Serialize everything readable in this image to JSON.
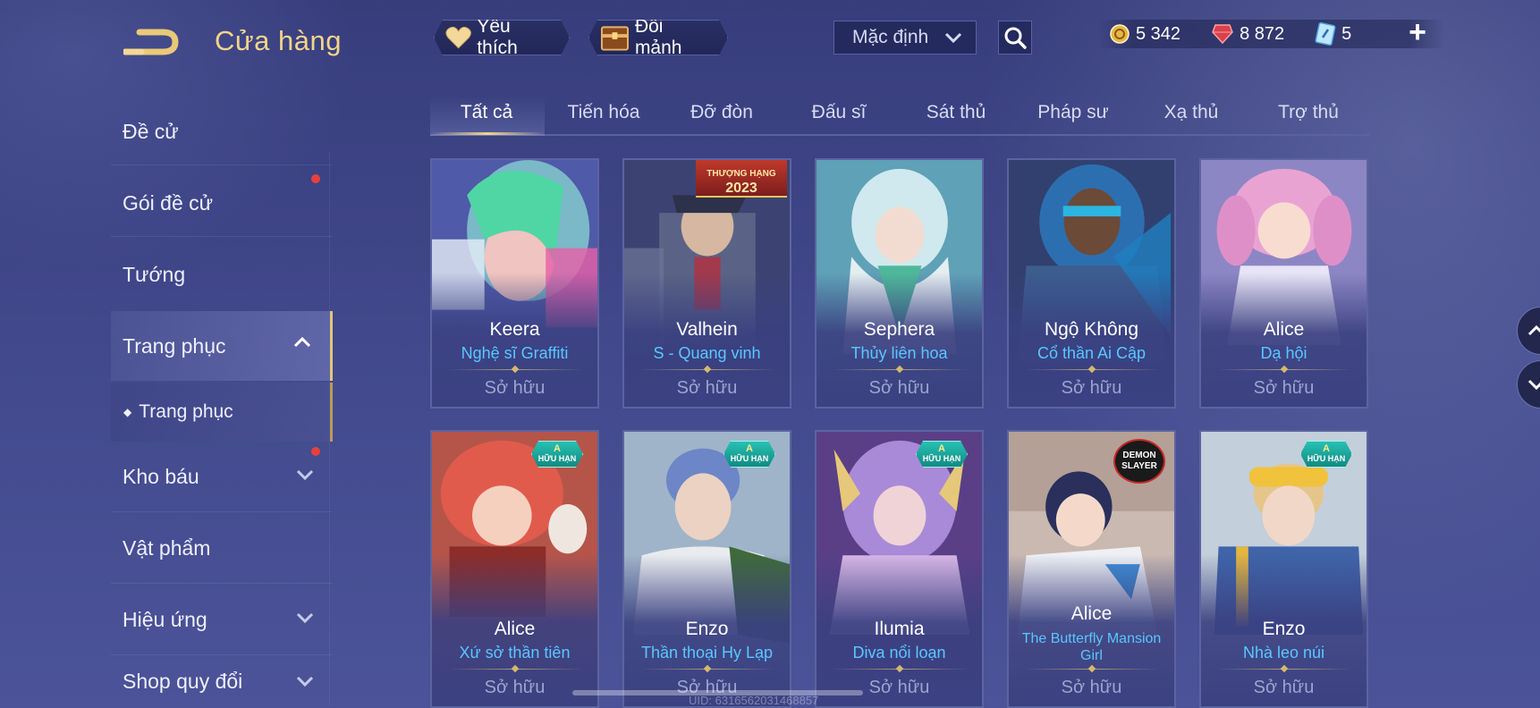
{
  "header": {
    "title": "Cửa hàng",
    "favorites_label": "Yêu thích",
    "exchange_label": "Đổi mảnh",
    "sort_value": "Mặc định"
  },
  "currency": {
    "gold": "5 342",
    "gems": "8 872",
    "vouchers": "5"
  },
  "sidebar": {
    "items": [
      {
        "label": "Đề cử"
      },
      {
        "label": "Gói đề cử"
      },
      {
        "label": "Tướng"
      },
      {
        "label": "Trang phục"
      },
      {
        "label": "Trang phục"
      },
      {
        "label": "Kho báu"
      },
      {
        "label": "Vật phẩm"
      },
      {
        "label": "Hiệu ứng"
      },
      {
        "label": "Shop quy đổi"
      }
    ]
  },
  "tabs": [
    "Tất cả",
    "Tiến hóa",
    "Đỡ đòn",
    "Đấu sĩ",
    "Sát thủ",
    "Pháp sư",
    "Xạ thủ",
    "Trợ thủ"
  ],
  "cards": [
    {
      "hero": "Keera",
      "skin": "Nghệ sĩ Graffiti",
      "status": "Sở hữu"
    },
    {
      "hero": "Valhein",
      "skin": "S - Quang vinh",
      "status": "Sở hữu",
      "ribbon": "THƯỢNG HẠNG\n2023"
    },
    {
      "hero": "Sephera",
      "skin": "Thủy liên hoa",
      "status": "Sở hữu"
    },
    {
      "hero": "Ngộ Không",
      "skin": "Cổ thần Ai Cập",
      "status": "Sở hữu"
    },
    {
      "hero": "Alice",
      "skin": "Dạ hội",
      "status": "Sở hữu"
    },
    {
      "hero": "Alice",
      "skin": "Xứ sở thần tiên",
      "status": "Sở hữu",
      "badge": "A HỮU HẠN"
    },
    {
      "hero": "Enzo",
      "skin": "Thần thoại Hy Lạp",
      "status": "Sở hữu",
      "badge": "A HỮU HẠN"
    },
    {
      "hero": "Ilumia",
      "skin": "Diva nổi loạn",
      "status": "Sở hữu",
      "badge": "A HỮU HẠN"
    },
    {
      "hero": "Alice",
      "skin": "The Butterfly Mansion Girl",
      "status": "Sở hữu",
      "logo": "DEMON SLAYER"
    },
    {
      "hero": "Enzo",
      "skin": "Nhà leo núi",
      "status": "Sở hữu",
      "badge": "A HỮU HẠN"
    }
  ],
  "badge": {
    "grade": "A",
    "label": "HỮU HẠN"
  },
  "ribbon": {
    "line1": "THƯỢNG HẠNG",
    "line2": "2023"
  },
  "logo": {
    "line1": "DEMON",
    "line2": "SLAYER"
  },
  "uid": "UID: 6316562031468857",
  "colors": {
    "accent_gold": "#f1d58a",
    "skin_name": "#59c7ff",
    "owned": "#9ea4cf",
    "background": "#3d4384"
  }
}
